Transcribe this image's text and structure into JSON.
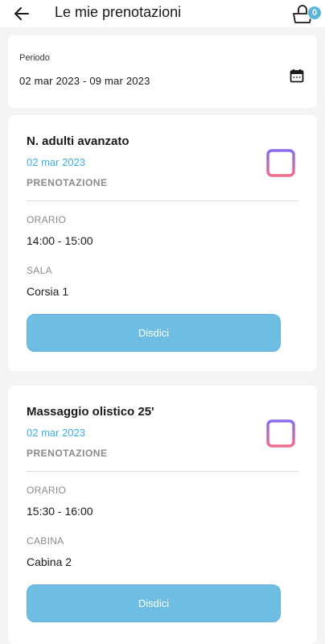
{
  "header": {
    "title": "Le mie prenotazioni",
    "back_icon": "arrow-left-icon",
    "basket_icon": "basket-icon",
    "basket_count": "0"
  },
  "period": {
    "label": "Periodo",
    "value": "02 mar 2023 - 09 mar 2023",
    "icon": "calendar-icon"
  },
  "bookings": [
    {
      "title": "N. adulti avanzato",
      "date": "02 mar 2023",
      "type": "PRENOTAZIONE",
      "time_label": "ORARIO",
      "time": "14:00 - 15:00",
      "place_label": "SALA",
      "place": "Corsia 1",
      "cancel_label": "Disdici",
      "icon": "calendar-icon"
    },
    {
      "title": "Massaggio olistico 25'",
      "date": "02 mar 2023",
      "type": "PRENOTAZIONE",
      "time_label": "ORARIO",
      "time": "15:30 - 16:00",
      "place_label": "CABINA",
      "place": "Cabina 2",
      "cancel_label": "Disdici",
      "icon": "calendar-icon"
    }
  ],
  "colors": {
    "accent": "#3eaee6",
    "button": "#6ebde3",
    "icon_gradient_top": "#8a6cf0",
    "icon_gradient_bottom": "#f06c8a"
  }
}
